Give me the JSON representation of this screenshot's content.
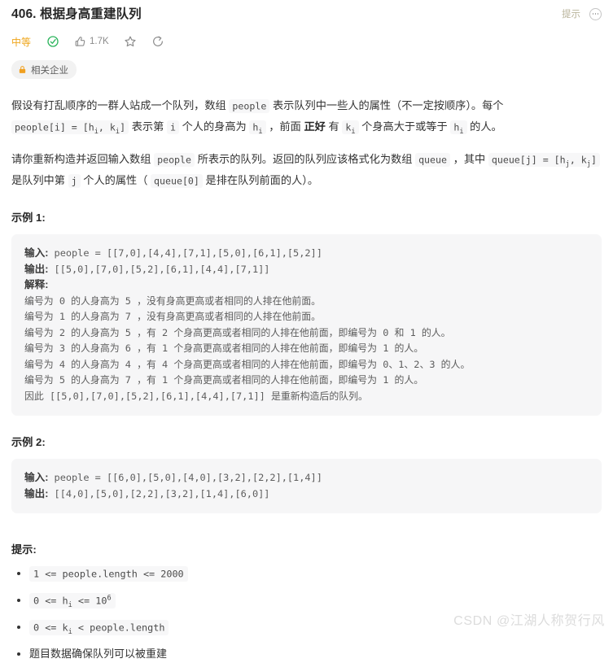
{
  "header": {
    "title": "406. 根据身高重建队列",
    "hint_label": "提示",
    "more_icon": "more-horizontal-icon"
  },
  "meta": {
    "difficulty": "中等",
    "difficulty_color": "#efa51a",
    "solved_icon": "check-circle-icon",
    "like_icon": "thumbs-up-icon",
    "like_count": "1.7K",
    "star_icon": "star-icon",
    "share_icon": "share-icon"
  },
  "company_tag": {
    "lock_icon": "lock-icon",
    "label": "相关企业"
  },
  "description": {
    "p1": {
      "t1": "假设有打乱顺序的一群人站成一个队列，数组 ",
      "c1": "people",
      "t2": " 表示队列中一些人的属性（不一定按顺序）。每个 ",
      "c2": "people[i] = [h",
      "c2sub1": "i",
      "c2b": ", k",
      "c2sub2": "i",
      "c2c": "]",
      "t3": " 表示第 ",
      "c3": "i",
      "t4": " 个人的身高为 ",
      "c4": "h",
      "c4sub": "i",
      "t5": " ，前面 ",
      "bold1": "正好",
      "t6": " 有 ",
      "c5": "k",
      "c5sub": "i",
      "t7": " 个身高大于或等于 ",
      "c6": "h",
      "c6sub": "i",
      "t8": " 的人。"
    },
    "p2": {
      "t1": "请你重新构造并返回输入数组 ",
      "c1": "people",
      "t2": " 所表示的队列。返回的队列应该格式化为数组 ",
      "c2": "queue",
      "t3": " ，其中 ",
      "c3": "queue[j] = [h",
      "c3sub1": "j",
      "c3b": ", k",
      "c3sub2": "j",
      "c3c": "]",
      "t4": " 是队列中第 ",
      "c4": "j",
      "t5": " 个人的属性（ ",
      "c5": "queue[0]",
      "t6": " 是排在队列前面的人）。"
    }
  },
  "examples": [
    {
      "title": "示例 1:",
      "input_label": "输入:",
      "input_value": " people = [[7,0],[4,4],[7,1],[5,0],[6,1],[5,2]]",
      "output_label": "输出:",
      "output_value": " [[5,0],[7,0],[5,2],[6,1],[4,4],[7,1]]",
      "explain_label": "解释:",
      "explain_lines": [
        "编号为 0 的人身高为 5 ，没有身高更高或者相同的人排在他前面。",
        "编号为 1 的人身高为 7 ，没有身高更高或者相同的人排在他前面。",
        "编号为 2 的人身高为 5 ，有 2 个身高更高或者相同的人排在他前面，即编号为 0 和 1 的人。",
        "编号为 3 的人身高为 6 ，有 1 个身高更高或者相同的人排在他前面，即编号为 1 的人。",
        "编号为 4 的人身高为 4 ，有 4 个身高更高或者相同的人排在他前面，即编号为 0、1、2、3 的人。",
        "编号为 5 的人身高为 7 ，有 1 个身高更高或者相同的人排在他前面，即编号为 1 的人。",
        "因此 [[5,0],[7,0],[5,2],[6,1],[4,4],[7,1]] 是重新构造后的队列。"
      ]
    },
    {
      "title": "示例 2:",
      "input_label": "输入:",
      "input_value": " people = [[6,0],[5,0],[4,0],[3,2],[2,2],[1,4]]",
      "output_label": "输出:",
      "output_value": " [[4,0],[5,0],[2,2],[3,2],[1,4],[6,0]]"
    }
  ],
  "hints": {
    "title": "提示:",
    "items": [
      {
        "type": "code",
        "pre": "1 <= people.length <= 2000"
      },
      {
        "type": "code_sub_sup",
        "pre": "0 <= h",
        "sub": "i",
        "mid": " <= 10",
        "sup": "6"
      },
      {
        "type": "code_sub",
        "pre": "0 <= k",
        "sub": "i",
        "mid": " < people.length"
      },
      {
        "type": "text",
        "pre": "题目数据确保队列可以被重建"
      }
    ]
  },
  "watermark": "CSDN @江湖人称贺行风"
}
